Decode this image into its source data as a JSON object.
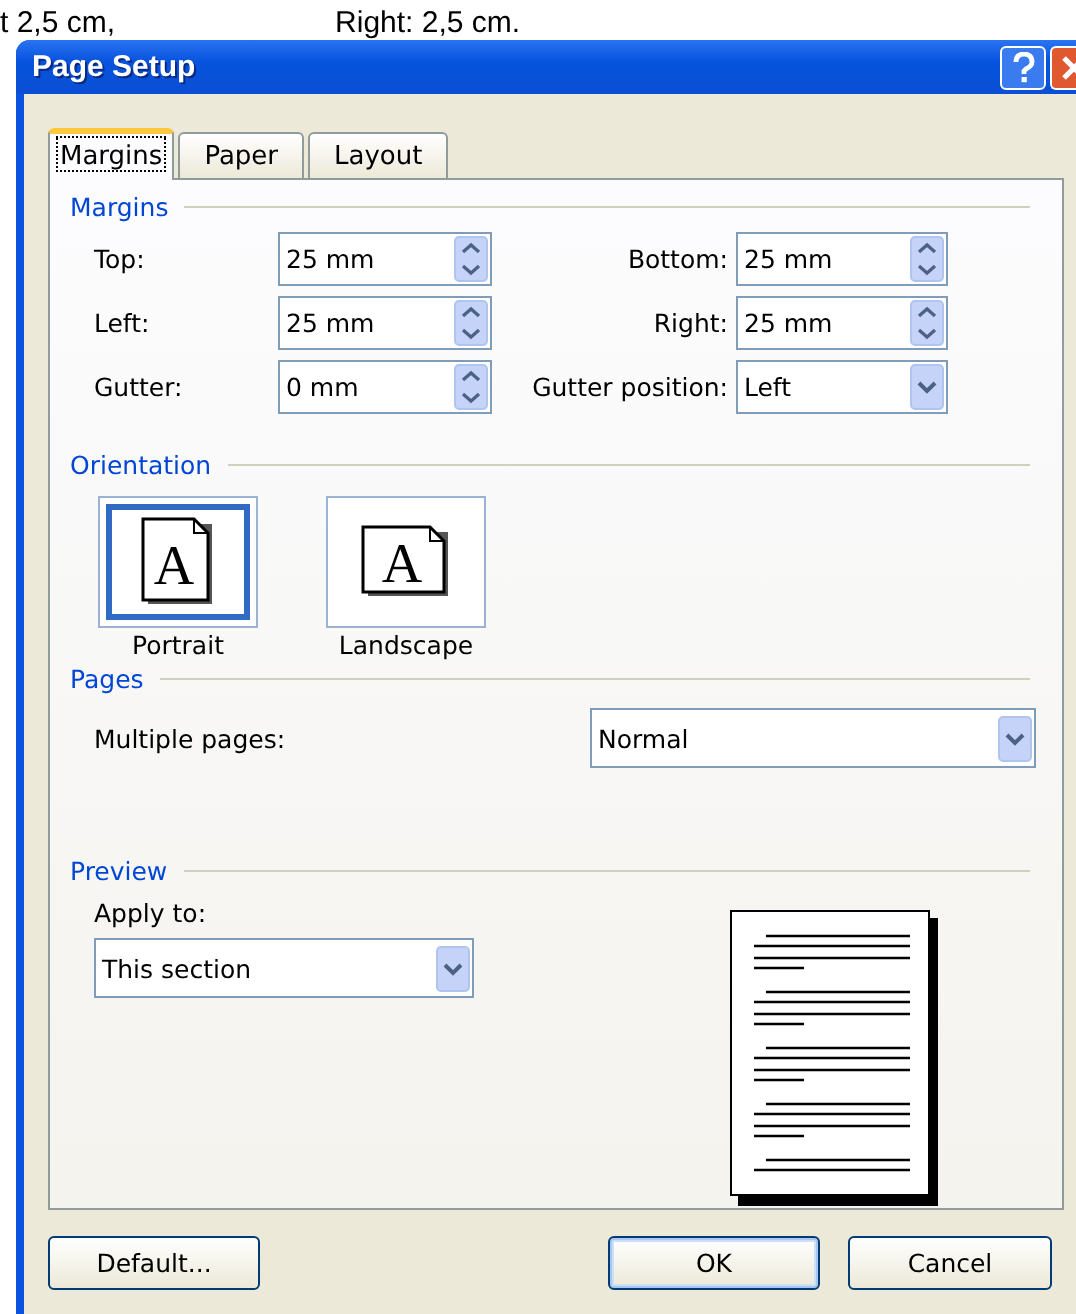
{
  "background_text": [
    "t 2,5 cm,",
    "Right: 2,5 cm."
  ],
  "window": {
    "title": "Page Setup"
  },
  "tabs": [
    {
      "label": "Margins",
      "selected": true
    },
    {
      "label": "Paper",
      "selected": false
    },
    {
      "label": "Layout",
      "selected": false
    }
  ],
  "margins": {
    "heading": "Margins",
    "fields": [
      {
        "label": "Top:",
        "value": "25 mm",
        "kind": "spin"
      },
      {
        "label": "Bottom:",
        "value": "25 mm",
        "kind": "spin"
      },
      {
        "label": "Left:",
        "value": "25 mm",
        "kind": "spin"
      },
      {
        "label": "Right:",
        "value": "25 mm",
        "kind": "spin"
      },
      {
        "label": "Gutter:",
        "value": "0 mm",
        "kind": "spin"
      },
      {
        "label": "Gutter position:",
        "value": "Left",
        "kind": "dropdown"
      }
    ]
  },
  "orientation": {
    "heading": "Orientation",
    "options": [
      {
        "label": "Portrait",
        "kind": "portrait",
        "glyph": "A",
        "selected": true
      },
      {
        "label": "Landscape",
        "kind": "landscape",
        "glyph": "A",
        "selected": false
      }
    ]
  },
  "pages": {
    "heading": "Pages",
    "label": "Multiple pages:",
    "value": "Normal"
  },
  "preview": {
    "heading": "Preview",
    "label": "Apply to:",
    "value": "This section"
  },
  "buttons": [
    {
      "label": "Default...",
      "default": false
    },
    {
      "label": "OK",
      "default": true
    },
    {
      "label": "Cancel",
      "default": false
    }
  ]
}
